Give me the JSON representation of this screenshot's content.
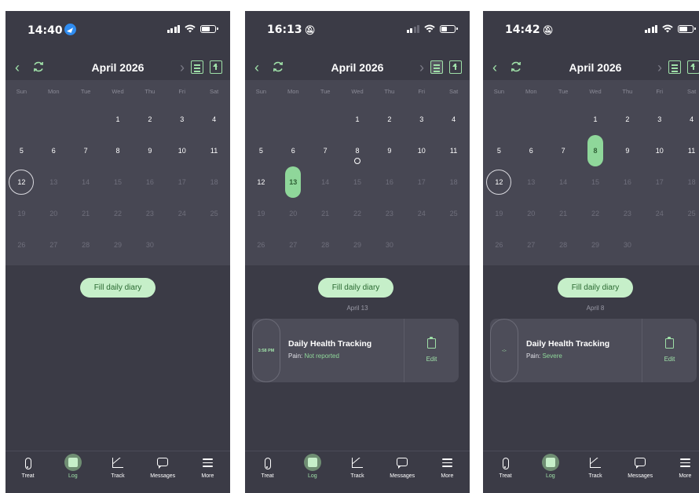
{
  "weekdays": [
    "Sun",
    "Mon",
    "Tue",
    "Wed",
    "Thu",
    "Fri",
    "Sat"
  ],
  "fill_button": "Fill daily diary",
  "edit_label": "Edit",
  "card_title": "Daily Health Tracking",
  "pain_label": "Pain:",
  "tabs": [
    "Treat",
    "Log",
    "Track",
    "Messages",
    "More"
  ],
  "colors": {
    "accent": "#8fd79a",
    "background": "#3b3b46",
    "calendar": "#474753"
  },
  "screens": [
    {
      "status_time": "14:40",
      "month_title": "April 2026",
      "today": 12,
      "selected": null
    },
    {
      "status_time": "16:13",
      "month_title": "April 2026",
      "today": 12,
      "selected": 13,
      "marked": 8,
      "sub_date": "April 13",
      "entry": {
        "time": "3:58 PM",
        "pain_value": "Not reported"
      }
    },
    {
      "status_time": "14:42",
      "month_title": "April 2026",
      "today": 12,
      "selected": 8,
      "sub_date": "April 8",
      "entry": {
        "time": "-:-",
        "pain_value": "Severe"
      }
    }
  ],
  "calendar": {
    "rows": [
      [
        "",
        "",
        "",
        "1",
        "2",
        "3",
        "4"
      ],
      [
        "5",
        "6",
        "7",
        "8",
        "9",
        "10",
        "11"
      ],
      [
        "12",
        "13",
        "14",
        "15",
        "16",
        "17",
        "18"
      ],
      [
        "19",
        "20",
        "21",
        "22",
        "23",
        "24",
        "25"
      ],
      [
        "26",
        "27",
        "28",
        "29",
        "30",
        "",
        ""
      ]
    ]
  }
}
